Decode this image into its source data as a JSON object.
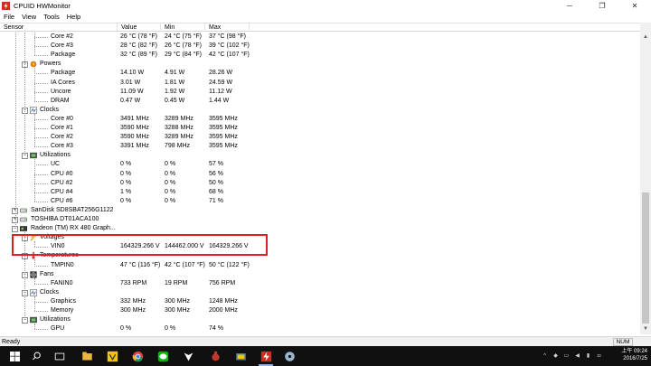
{
  "window": {
    "title": "CPUID HWMonitor",
    "minimize": "─",
    "maximize": "❐",
    "close": "✕"
  },
  "menu": [
    "File",
    "View",
    "Tools",
    "Help"
  ],
  "columns": {
    "sensor": "Sensor",
    "value": "Value",
    "min": "Min",
    "max": "Max"
  },
  "rows": [
    {
      "type": "item",
      "name": "Core #2",
      "value": "26 °C  (78 °F)",
      "min": "24 °C  (75 °F)",
      "max": "37 °C  (98 °F)"
    },
    {
      "type": "item",
      "name": "Core #3",
      "value": "28 °C  (82 °F)",
      "min": "26 °C  (78 °F)",
      "max": "39 °C  (102 °F)"
    },
    {
      "type": "item",
      "name": "Package",
      "value": "32 °C  (89 °F)",
      "min": "29 °C  (84 °F)",
      "max": "42 °C  (107 °F)"
    },
    {
      "type": "group",
      "name": "Powers",
      "icon": "powers-icon"
    },
    {
      "type": "item",
      "name": "Package",
      "value": "14.10 W",
      "min": "4.91 W",
      "max": "28.26 W"
    },
    {
      "type": "item",
      "name": "IA Cores",
      "value": "3.01 W",
      "min": "1.81 W",
      "max": "24.59 W"
    },
    {
      "type": "item",
      "name": "Uncore",
      "value": "11.09 W",
      "min": "1.92 W",
      "max": "11.12 W"
    },
    {
      "type": "item",
      "name": "DRAM",
      "value": "0.47 W",
      "min": "0.45 W",
      "max": "1.44 W"
    },
    {
      "type": "group",
      "name": "Clocks",
      "icon": "clocks-icon"
    },
    {
      "type": "item",
      "name": "Core #0",
      "value": "3491 MHz",
      "min": "3289 MHz",
      "max": "3595 MHz"
    },
    {
      "type": "item",
      "name": "Core #1",
      "value": "3590 MHz",
      "min": "3288 MHz",
      "max": "3595 MHz"
    },
    {
      "type": "item",
      "name": "Core #2",
      "value": "3590 MHz",
      "min": "3289 MHz",
      "max": "3595 MHz"
    },
    {
      "type": "item",
      "name": "Core #3",
      "value": "3391 MHz",
      "min": "798 MHz",
      "max": "3595 MHz"
    },
    {
      "type": "group",
      "name": "Utilizations",
      "icon": "utilizations-icon"
    },
    {
      "type": "item",
      "name": "UC",
      "value": "0 %",
      "min": "0 %",
      "max": "57 %"
    },
    {
      "type": "item",
      "name": "CPU #0",
      "value": "0 %",
      "min": "0 %",
      "max": "56 %"
    },
    {
      "type": "item",
      "name": "CPU #2",
      "value": "0 %",
      "min": "0 %",
      "max": "50 %"
    },
    {
      "type": "item",
      "name": "CPU #4",
      "value": "1 %",
      "min": "0 %",
      "max": "68 %"
    },
    {
      "type": "item",
      "name": "CPU #6",
      "value": "0 %",
      "min": "0 %",
      "max": "71 %"
    },
    {
      "type": "device",
      "name": "SanDisk SD8SBAT256G1122",
      "icon": "drive-icon",
      "expander": "+"
    },
    {
      "type": "device",
      "name": "TOSHIBA DT01ACA100",
      "icon": "drive-icon",
      "expander": "+"
    },
    {
      "type": "device",
      "name": "Radeon (TM) RX 480 Graph...",
      "icon": "gpu-icon",
      "expander": "−"
    },
    {
      "type": "group",
      "name": "Voltages",
      "icon": "voltages-icon"
    },
    {
      "type": "item",
      "name": "VIN0",
      "value": "164329.266 V",
      "min": "144462.000 V",
      "max": "164329.266 V"
    },
    {
      "type": "group",
      "name": "Temperatures",
      "icon": "temperatures-icon"
    },
    {
      "type": "item",
      "name": "TMPIN0",
      "value": "47 °C  (116 °F)",
      "min": "42 °C  (107 °F)",
      "max": "50 °C  (122 °F)"
    },
    {
      "type": "group",
      "name": "Fans",
      "icon": "fans-icon"
    },
    {
      "type": "item",
      "name": "FANIN0",
      "value": "733 RPM",
      "min": "19 RPM",
      "max": "756 RPM"
    },
    {
      "type": "group",
      "name": "Clocks",
      "icon": "clocks-icon"
    },
    {
      "type": "item",
      "name": "Graphics",
      "value": "332 MHz",
      "min": "300 MHz",
      "max": "1248 MHz"
    },
    {
      "type": "item",
      "name": "Memory",
      "value": "300 MHz",
      "min": "300 MHz",
      "max": "2000 MHz"
    },
    {
      "type": "group",
      "name": "Utilizations",
      "icon": "utilizations-icon"
    },
    {
      "type": "item",
      "name": "GPU",
      "value": "0 %",
      "min": "0 %",
      "max": "74 %"
    }
  ],
  "status": {
    "text": "Ready",
    "num": "NUM"
  },
  "taskbar": {
    "time": "上午 09:24",
    "date": "2016/7/25"
  },
  "colors": {
    "highlight": "#e02020",
    "app_red": "#d62a1e",
    "taskbar": "#101010"
  }
}
